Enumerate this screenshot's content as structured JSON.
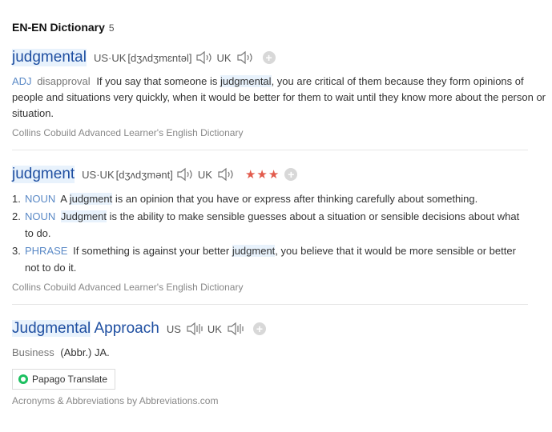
{
  "section": {
    "title": "EN-EN Dictionary",
    "count": "5"
  },
  "entries": [
    {
      "headword": "judgmental",
      "pron_label": "US·UK",
      "pron_text": "[dʒʌdʒmɛntəl]",
      "uk_label": "UK",
      "pos": "ADJ",
      "register": "disapproval",
      "def_part1": "If you say that someone is ",
      "def_highlight": "judgmental",
      "def_part2": ", you are critical of them because they form opinions of people and situations very quickly, when it would be better for them to wait until they know more about the person or situation.",
      "source": "Collins Cobuild Advanced Learner's English Dictionary",
      "plus_icon": "+"
    },
    {
      "headword": "judgment",
      "pron_label": "US·UK",
      "pron_text": "[dʒʌdʒmənt]",
      "uk_label": "UK",
      "stars": "★★★",
      "plus_icon": "+",
      "senses": [
        {
          "num": "1.",
          "pos": "NOUN",
          "pre": "A ",
          "highlight": "judgment",
          "post": " is an opinion that you have or express after thinking carefully about something."
        },
        {
          "num": "2.",
          "pos": "NOUN",
          "pre": "",
          "highlight": "Judgment",
          "post": " is the ability to make sensible guesses about a situation or sensible decisions about what to do."
        },
        {
          "num": "3.",
          "pos": "PHRASE",
          "pre": "If something is against your better ",
          "highlight": "judgment",
          "post": ", you believe that it would be more sensible or better not to do it."
        }
      ],
      "source": "Collins Cobuild Advanced Learner's English Dictionary"
    },
    {
      "headword_part1": "Judgmental",
      "headword_part2": " Approach",
      "us_label": "US",
      "uk_label": "UK",
      "plus_icon": "+",
      "category": "Business",
      "definition": "(Abbr.) JA.",
      "translate_button": "Papago Translate",
      "source": "Acronyms & Abbreviations by Abbreviations.com"
    }
  ],
  "icons": {
    "speaker": "speaker-icon",
    "speaker_wave": "speaker-wave-icon",
    "plus": "plus-circle-icon",
    "papago": "papago-logo-icon"
  }
}
